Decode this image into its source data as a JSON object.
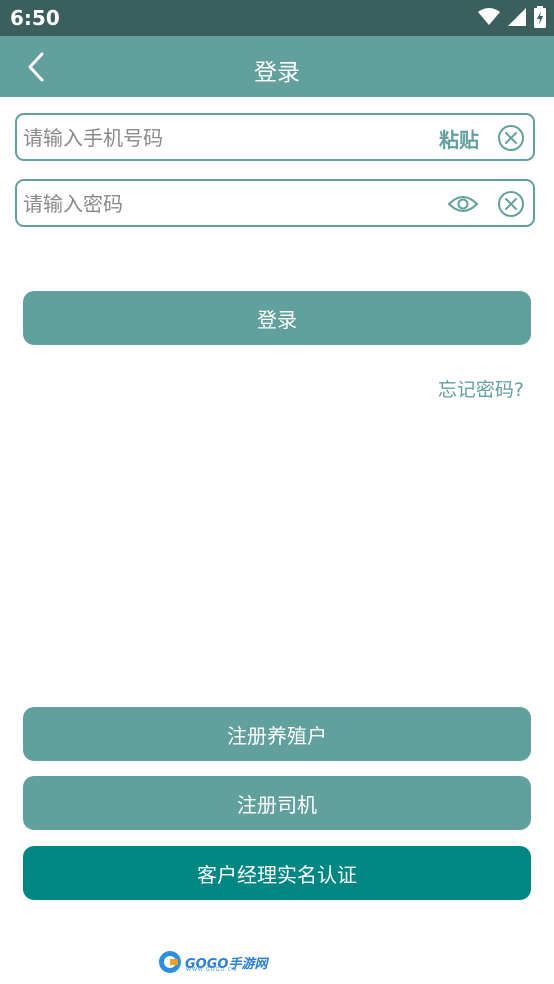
{
  "status_bar": {
    "time": "6:50",
    "icons": [
      "wifi-icon",
      "signal-icon",
      "battery-charging-icon"
    ]
  },
  "app_bar": {
    "back_icon": "chevron-left-icon",
    "title": "登录"
  },
  "phone_field": {
    "placeholder": "请输入手机号码",
    "value": "",
    "paste_label": "粘贴",
    "clear_icon": "clear-circle-icon"
  },
  "password_field": {
    "placeholder": "请输入密码",
    "value": "",
    "toggle_icon": "eye-icon",
    "clear_icon": "clear-circle-icon"
  },
  "login_button": {
    "label": "登录"
  },
  "forgot_password": {
    "label": "忘记密码?"
  },
  "bottom_buttons": {
    "register_farmer": "注册养殖户",
    "register_driver": "注册司机",
    "manager_verify": "客户经理实名认证"
  },
  "watermark": {
    "text": "GOGO手游网",
    "sub": "WWW.GOGO.CN"
  },
  "colors": {
    "status_bar": "#3b5f5c",
    "primary": "#62a09e",
    "primary_dark": "#008784",
    "background": "#ffffff"
  }
}
